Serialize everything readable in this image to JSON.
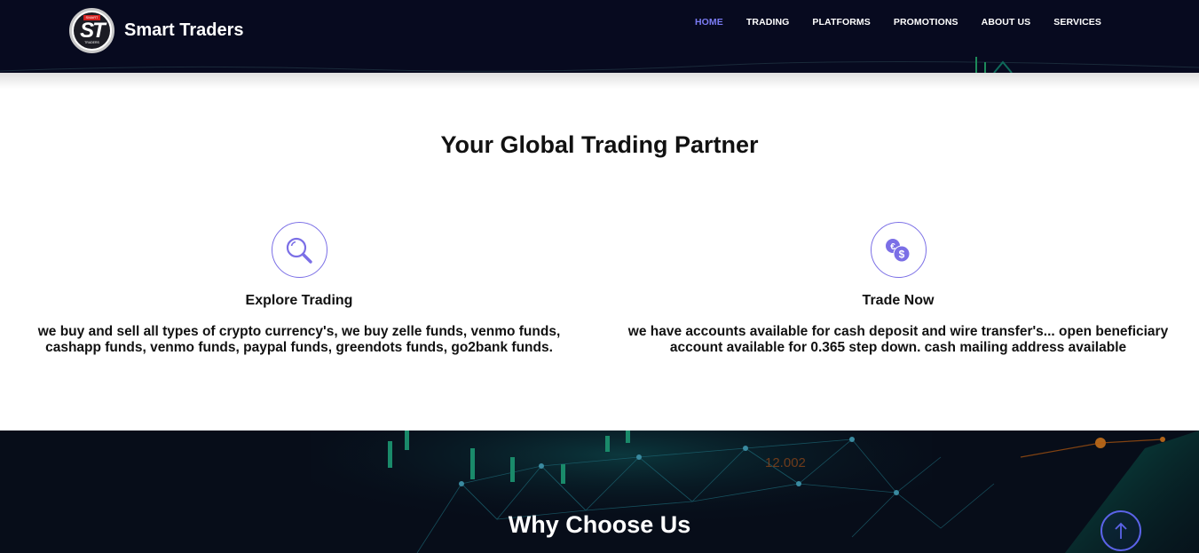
{
  "header": {
    "brand_name": "Smart Traders",
    "logo_monogram": "ST",
    "logo_tag_top": "SMART",
    "logo_tag_bottom": "TRADERS",
    "nav": [
      {
        "label": "HOME",
        "active": true
      },
      {
        "label": "TRADING",
        "active": false
      },
      {
        "label": "PLATFORMS",
        "active": false
      },
      {
        "label": "PROMOTIONS",
        "active": false
      },
      {
        "label": "ABOUT US",
        "active": false
      },
      {
        "label": "SERVICES",
        "active": false
      }
    ]
  },
  "main": {
    "title": "Your Global Trading Partner",
    "features": [
      {
        "icon": "search-icon",
        "title": "Explore Trading",
        "text": "we buy and sell all types of crypto currency's, we buy zelle funds, venmo funds, cashapp funds, venmo funds, paypal funds, greendots funds, go2bank funds."
      },
      {
        "icon": "currency-exchange-icon",
        "title": "Trade Now",
        "text": "we have accounts available for cash deposit and wire transfer's... open beneficiary account available for 0.365 step down. cash mailing address available"
      }
    ]
  },
  "why": {
    "title": "Why Choose Us",
    "background_figure": "12.002"
  },
  "scroll_top": {
    "icon": "arrow-up-icon"
  },
  "colors": {
    "header_bg": "#070a1f",
    "accent": "#7b6fe6",
    "nav_active": "#7b7cf4",
    "dark_section_bg": "#070d19"
  }
}
